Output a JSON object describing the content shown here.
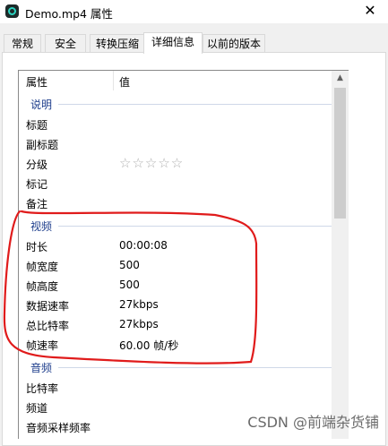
{
  "window": {
    "title": "Demo.mp4 属性",
    "app_icon": "media-player-icon",
    "close_glyph": "✕"
  },
  "tabs": [
    {
      "label": "常规",
      "active": false
    },
    {
      "label": "安全",
      "active": false
    },
    {
      "label": "转换压缩",
      "active": false
    },
    {
      "label": "详细信息",
      "active": true
    },
    {
      "label": "以前的版本",
      "active": false
    }
  ],
  "list": {
    "col_property": "属性",
    "col_value": "值",
    "groups": {
      "description": "说明",
      "video": "视频",
      "audio": "音频"
    },
    "description_rows": [
      {
        "key": "标题",
        "value": ""
      },
      {
        "key": "副标题",
        "value": ""
      },
      {
        "key": "分级",
        "value": "☆☆☆☆☆"
      },
      {
        "key": "标记",
        "value": ""
      },
      {
        "key": "备注",
        "value": ""
      }
    ],
    "video_rows": [
      {
        "key": "时长",
        "value": "00:00:08"
      },
      {
        "key": "帧宽度",
        "value": "500"
      },
      {
        "key": "帧高度",
        "value": "500"
      },
      {
        "key": "数据速率",
        "value": "27kbps"
      },
      {
        "key": "总比特率",
        "value": "27kbps"
      },
      {
        "key": "帧速率",
        "value": "60.00 帧/秒"
      }
    ],
    "audio_rows": [
      {
        "key": "比特率",
        "value": ""
      },
      {
        "key": "频道",
        "value": ""
      },
      {
        "key": "音频采样频率",
        "value": ""
      }
    ]
  },
  "rating_stars": 0,
  "annotation_color": "#e01b1b",
  "watermark": "CSDN @前端杂货铺"
}
